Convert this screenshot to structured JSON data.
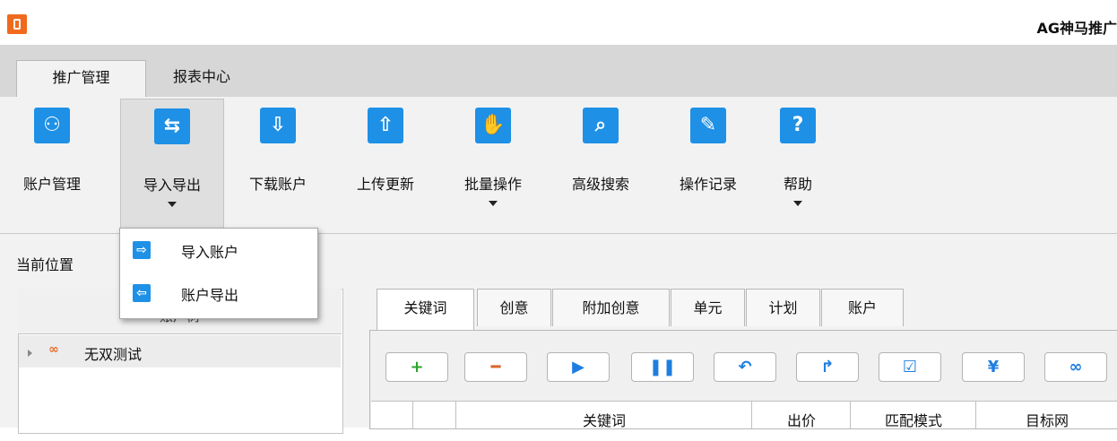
{
  "app": {
    "title": "AG神马推广"
  },
  "menu_tabs": [
    {
      "label": "推广管理"
    },
    {
      "label": "报表中心"
    }
  ],
  "ribbon": [
    {
      "label": "账户管理",
      "icon": "person-icon",
      "glyph": "⚇"
    },
    {
      "label": "导入导出",
      "icon": "import-export-icon",
      "glyph": "⇆"
    },
    {
      "label": "下载账户",
      "icon": "download-account-icon",
      "glyph": "⇩"
    },
    {
      "label": "上传更新",
      "icon": "upload-icon",
      "glyph": "⇧"
    },
    {
      "label": "批量操作",
      "icon": "batch-icon",
      "glyph": "✋"
    },
    {
      "label": "高级搜索",
      "icon": "search-doc-icon",
      "glyph": "⌕"
    },
    {
      "label": "操作记录",
      "icon": "edit-log-icon",
      "glyph": "✎"
    },
    {
      "label": "帮助",
      "icon": "help-icon",
      "glyph": "?"
    }
  ],
  "dropdown": {
    "items": [
      {
        "label": "导入账户",
        "glyph": "⇨"
      },
      {
        "label": "账户导出",
        "glyph": "⇦"
      }
    ]
  },
  "location_label": "当前位置",
  "left_panel": {
    "header": "账户树",
    "tree": [
      {
        "label": "无双测试"
      }
    ]
  },
  "data_tabs": [
    {
      "label": "关键词"
    },
    {
      "label": "创意"
    },
    {
      "label": "附加创意"
    },
    {
      "label": "单元"
    },
    {
      "label": "计划"
    },
    {
      "label": "账户"
    }
  ],
  "toolbar": [
    {
      "name": "add-button",
      "glyph": "+",
      "color": "#2aa52a"
    },
    {
      "name": "delete-button",
      "glyph": "━",
      "color": "#d9662b"
    },
    {
      "name": "enable-button",
      "glyph": "▶",
      "color": "#1e7ee0"
    },
    {
      "name": "pause-button",
      "glyph": "❚❚",
      "color": "#1e7ee0"
    },
    {
      "name": "undo-button",
      "glyph": "↶",
      "color": "#1e7ee0"
    },
    {
      "name": "redo-button",
      "glyph": "↱",
      "color": "#1e7ee0"
    },
    {
      "name": "edit-button",
      "glyph": "☑",
      "color": "#1e7ee0"
    },
    {
      "name": "bid-button",
      "glyph": "¥",
      "color": "#1e7ee0"
    },
    {
      "name": "link-button",
      "glyph": "∞",
      "color": "#1e7ee0"
    }
  ],
  "grid": {
    "columns": [
      "",
      "",
      "关键词",
      "出价",
      "匹配模式",
      "目标网"
    ]
  },
  "colors": {
    "accent": "#1e90e6",
    "ribbon_bg": "#f2f2f2",
    "tabbar_bg": "#d7d7d7"
  }
}
